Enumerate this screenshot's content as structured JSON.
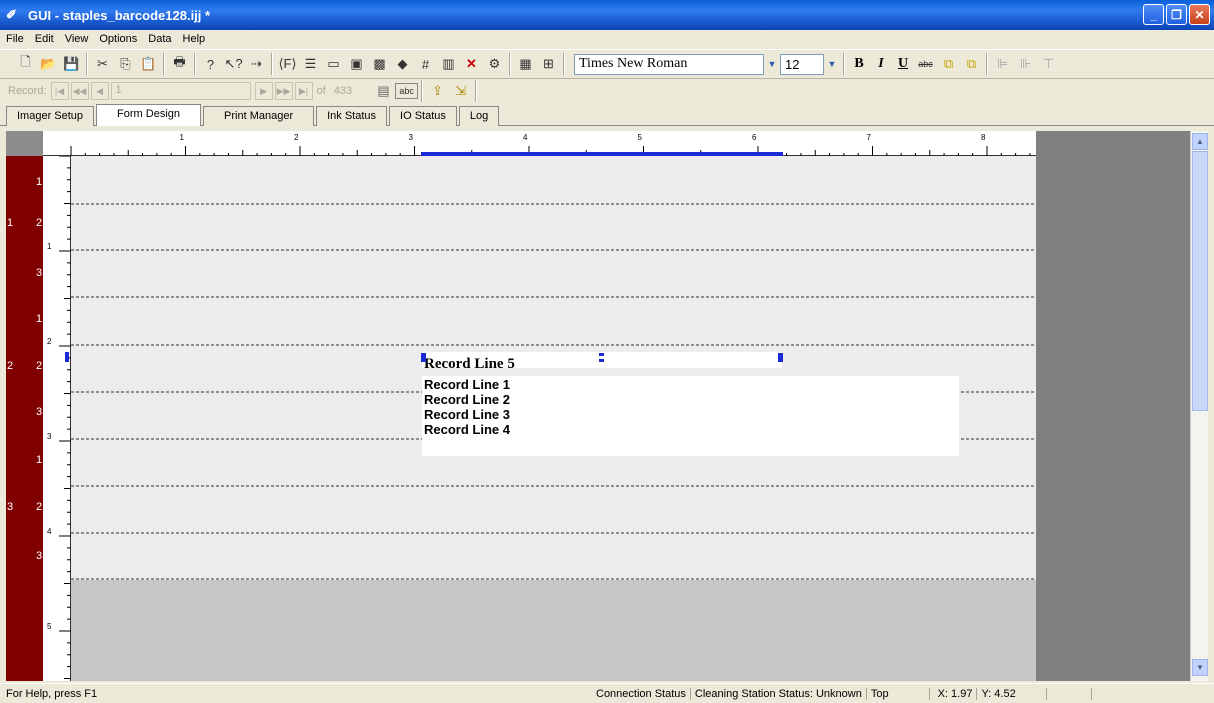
{
  "window": {
    "title": "GUI - staples_barcode128.ijj *"
  },
  "menu": [
    "File",
    "Edit",
    "View",
    "Options",
    "Data",
    "Help"
  ],
  "toolbar": {
    "font_name": "Times New Roman",
    "font_size": "12",
    "bold": "B",
    "italic": "I",
    "underline": "U"
  },
  "record_nav": {
    "label": "Record:",
    "current": "1",
    "of_label": "of",
    "total": "433"
  },
  "tabs": [
    "Imager Setup",
    "Form Design",
    "Print Manager",
    "Ink Status",
    "IO Status",
    "Log"
  ],
  "active_tab": "Form Design",
  "ruler": {
    "h_ticks": [
      "1",
      "2",
      "3",
      "4",
      "5",
      "6",
      "7",
      "8"
    ],
    "v_ticks": [
      "1",
      "2",
      "3",
      "4",
      "5"
    ],
    "red_labels": [
      "1",
      "1",
      "2",
      "3",
      "1",
      "2",
      "2",
      "3",
      "1",
      "3",
      "2",
      "3"
    ]
  },
  "canvas": {
    "record_lines": [
      "Record Line 1",
      "Record Line 2",
      "Record Line 3",
      "Record Line 4"
    ],
    "record_line_5": "Record Line 5"
  },
  "status": {
    "help": "For Help, press F1",
    "connection": "Connection Status",
    "cleaning": "Cleaning Station Status: Unknown",
    "position": "Top",
    "x": "X: 1.97",
    "y": "Y: 4.52"
  },
  "colors": {
    "title_blue": "#0a5fd8",
    "ruler_red": "#800000",
    "selection_blue": "#1a2bd6"
  }
}
